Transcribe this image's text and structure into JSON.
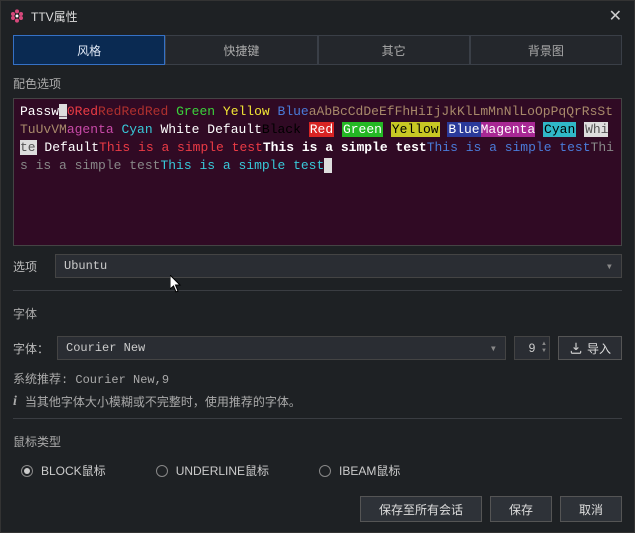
{
  "window": {
    "title": "TTV属性"
  },
  "tabs": [
    {
      "label": "风格",
      "active": true
    },
    {
      "label": "快捷键",
      "active": false
    },
    {
      "label": "其它",
      "active": false
    },
    {
      "label": "背景图",
      "active": false
    }
  ],
  "colorScheme": {
    "sectionLabel": "配色选项",
    "optionLabel": "选项",
    "selected": "Ubuntu",
    "preview": {
      "passw": "Passw",
      "underscore": "_",
      "zero": "0",
      "red_txt": "Red",
      "red_more": "RedRedRed",
      "green": "Green",
      "yellow": "Yellow",
      "blue": "Blue",
      "alpha": "aAbBcCdDeEfFhHiIjJkKlLmMnNlLoOpPqQrRsStTuUvVM",
      "magenta": "agenta",
      "cyan": "Cyan",
      "white": "White",
      "default": "Default",
      "black": "Black",
      "bg_red": "Red",
      "bg_green": "Green",
      "bg_yellow": "Yellow",
      "bg_blue": "Blue",
      "bg_magenta": "Magenta",
      "bg_cyan": "Cyan",
      "bg_white": "White",
      "default2": "Default",
      "simple1": "This is a simple test",
      "simple2": "This is a simple test",
      "simple3": "This is a simple test",
      "simple4": "This is a simple test",
      "simple5a": "This",
      "simple5b": " is a simple test"
    }
  },
  "font": {
    "sectionLabel": "字体",
    "label": "字体：",
    "family": "Courier New",
    "size": "9",
    "importLabel": "导入",
    "recommend": "系统推荐: Courier New,9",
    "hint": "当其他字体大小模糊或不完整时，使用推荐的字体。"
  },
  "cursor": {
    "sectionLabel": "鼠标类型",
    "options": [
      {
        "label": "BLOCK鼠标",
        "checked": true
      },
      {
        "label": "UNDERLINE鼠标",
        "checked": false
      },
      {
        "label": "IBEAM鼠标",
        "checked": false
      }
    ]
  },
  "footer": {
    "saveAll": "保存至所有会话",
    "save": "保存",
    "cancel": "取消"
  }
}
